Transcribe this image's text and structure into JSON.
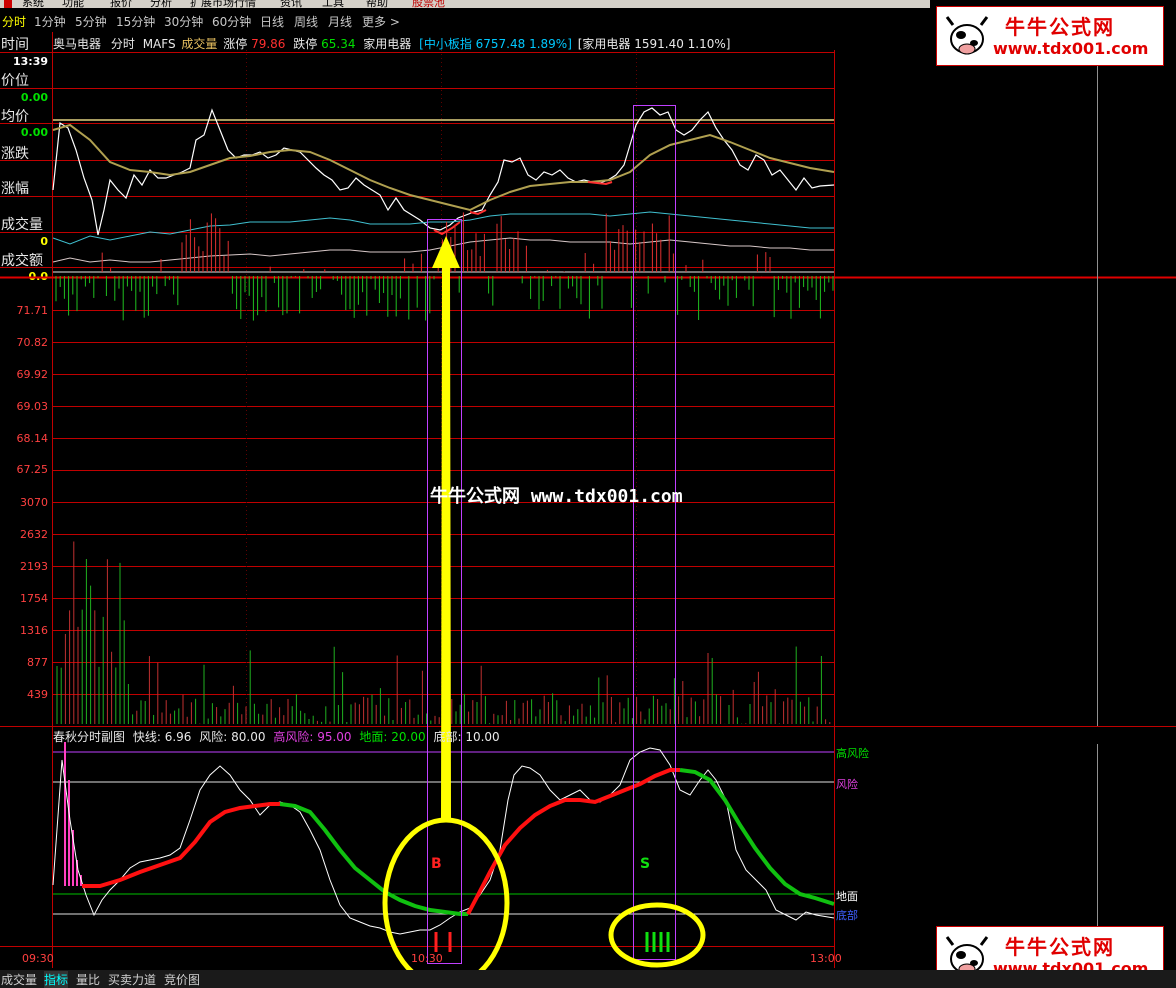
{
  "menu": [
    "系统",
    "功能",
    "报价",
    "分析",
    "扩展市场行情",
    "资讯",
    "工具",
    "帮助",
    "股票池"
  ],
  "period_tabs": [
    "分时",
    "1分钟",
    "5分钟",
    "15分钟",
    "30分钟",
    "60分钟",
    "日线",
    "周线",
    "月线",
    "更多 >"
  ],
  "left_panel": {
    "time_label": "时间",
    "time_value": "13:39",
    "price_label": "价位",
    "price_value": "0.00",
    "avg_label": "均价",
    "avg_value": "0.00",
    "change_label": "涨跌",
    "pct_label": "涨幅",
    "vol_label": "成交量",
    "vol_value": "0",
    "amount_label": "成交额",
    "amount_value": "0.0"
  },
  "info_line": {
    "stock": "奥马电器",
    "mode": "分时",
    "mafs": "MAFS",
    "vol": "成交量",
    "limit_up_label": "涨停",
    "limit_up": "79.86",
    "limit_down_label": "跌停",
    "limit_down": "65.34",
    "sector": "家用电器",
    "index": "[中小板指 6757.48 1.89%]",
    "sector_index": "[家用电器 1591.40 1.10%]"
  },
  "price_axis": [
    "71.71",
    "70.82",
    "69.92",
    "69.03",
    "68.14",
    "67.25"
  ],
  "volume_axis": [
    "3070",
    "2632",
    "2193",
    "1754",
    "1316",
    "877",
    "439"
  ],
  "indicator_line": {
    "name": "春秋分时副图",
    "fast_label": "快线:",
    "fast": "6.96",
    "risk_label": "风险:",
    "risk": "80.00",
    "high_risk_label": "高风险:",
    "high_risk": "95.00",
    "ground_label": "地面:",
    "ground": "20.00",
    "bottom_label": "底部:",
    "bottom": "10.00"
  },
  "right_labels": {
    "high_risk": "高风险",
    "risk": "风险",
    "ground": "地面",
    "bottom": "底部"
  },
  "markers": {
    "buy": "B",
    "sell": "S"
  },
  "time_axis": [
    "09:30",
    "10:30",
    "13:00"
  ],
  "watermark": {
    "title": "牛牛公式网",
    "url": "www.tdx001.com",
    "center": "牛牛公式网 www.tdx001.com"
  },
  "bottom_tabs": [
    "成交量",
    "指标",
    "量比",
    "买卖力道",
    "竞价图"
  ],
  "colors": {
    "grid": "#c00000",
    "up": "#ff3030",
    "down": "#00c000",
    "price": "#ffffff",
    "avg": "#c8c060",
    "box": "#c040ff",
    "highlight": "#ffff00"
  }
}
